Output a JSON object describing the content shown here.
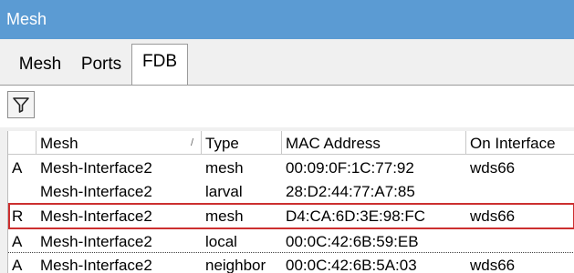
{
  "window": {
    "title": "Mesh"
  },
  "tabs": [
    {
      "label": "Mesh"
    },
    {
      "label": "Ports"
    },
    {
      "label": "FDB"
    }
  ],
  "toolbar": {
    "filter_icon": "filter-icon"
  },
  "table": {
    "columns": [
      "",
      "Mesh",
      "Type",
      "MAC Address",
      "On Interface"
    ],
    "sort_indicator": "/",
    "rows": [
      {
        "flag": "A",
        "mesh": "Mesh-Interface2",
        "type": "mesh",
        "mac": "00:09:0F:1C:77:92",
        "iface": "wds66"
      },
      {
        "flag": "",
        "mesh": "Mesh-Interface2",
        "type": "larval",
        "mac": "28:D2:44:77:A7:85",
        "iface": ""
      },
      {
        "flag": "R",
        "mesh": "Mesh-Interface2",
        "type": "mesh",
        "mac": "D4:CA:6D:3E:98:FC",
        "iface": "wds66"
      },
      {
        "flag": "A",
        "mesh": "Mesh-Interface2",
        "type": "local",
        "mac": "00:0C:42:6B:59:EB",
        "iface": ""
      },
      {
        "flag": "A",
        "mesh": "Mesh-Interface2",
        "type": "neighbor",
        "mac": "00:0C:42:6B:5A:03",
        "iface": "wds66"
      }
    ]
  },
  "colors": {
    "titlebar": "#5b9bd3",
    "selection": "#cc2f2f"
  }
}
